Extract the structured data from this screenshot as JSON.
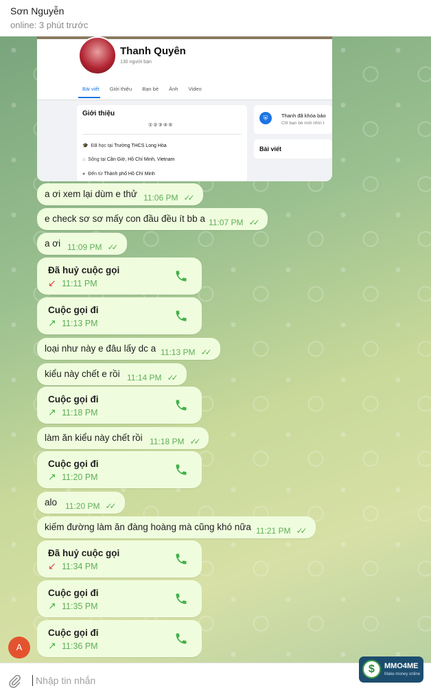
{
  "header": {
    "name": "Sơn Nguyễn",
    "status": "online: 3 phút trước"
  },
  "shared_screenshot": {
    "profile_name": "Thanh Quyên",
    "friends": "130 người bạn",
    "tabs": [
      "Bài viết",
      "Giới thiệu",
      "Bạn bè",
      "Ảnh",
      "Video"
    ],
    "intro_title": "Giới thiệu",
    "intro_dots": "①②③④⑤",
    "intro_rows": [
      {
        "prefix": "Đã học tại",
        "value": "Trường THCS Long Hòa"
      },
      {
        "prefix": "Sống tại",
        "value": "Cần Giờ, Hồ Chí Minh, Vietnam"
      },
      {
        "prefix": "Đến từ",
        "value": "Thành phố Hồ Chí Minh"
      }
    ],
    "lock_title": "Thanh đã khóa bảo",
    "lock_sub": "Chỉ bạn bè mới nhìn t",
    "posts_title": "Bài viết"
  },
  "messages": [
    {
      "type": "text",
      "text": "a ơi xem lại dùm e thử",
      "time": "11:06 PM"
    },
    {
      "type": "text",
      "text": "e check sơ sơ mấy con đầu đều  ít bb a",
      "time": "11:07 PM"
    },
    {
      "type": "text",
      "text": "a ơi",
      "time": "11:09 PM"
    },
    {
      "type": "call",
      "title": "Đã huỷ cuộc gọi",
      "time": "11:11 PM",
      "direction": "missed"
    },
    {
      "type": "call",
      "title": "Cuộc gọi đi",
      "time": "11:13 PM",
      "direction": "outgoing"
    },
    {
      "type": "text",
      "text": "loại như này e đâu lấy dc a",
      "time": "11:13 PM"
    },
    {
      "type": "text",
      "text": "kiểu này chết e rồi",
      "time": "11:14 PM"
    },
    {
      "type": "call",
      "title": "Cuộc gọi đi",
      "time": "11:18 PM",
      "direction": "outgoing"
    },
    {
      "type": "text",
      "text": "làm ăn kiểu này chết rồi",
      "time": "11:18 PM"
    },
    {
      "type": "call",
      "title": "Cuộc gọi đi",
      "time": "11:20 PM",
      "direction": "outgoing"
    },
    {
      "type": "text",
      "text": "alo",
      "time": "11:20 PM"
    },
    {
      "type": "text",
      "text": "kiếm đường làm ăn đàng hoàng mà cũng khó nữa",
      "time": "11:21 PM"
    },
    {
      "type": "call",
      "title": "Đã huỷ cuộc gọi",
      "time": "11:34 PM",
      "direction": "missed"
    },
    {
      "type": "call",
      "title": "Cuộc gọi đi",
      "time": "11:35 PM",
      "direction": "outgoing"
    },
    {
      "type": "call",
      "title": "Cuộc gọi đi",
      "time": "11:36 PM",
      "direction": "outgoing"
    }
  ],
  "sender_avatar": "A",
  "input": {
    "placeholder": "Nhập tin nhắn"
  },
  "watermark": {
    "name": "MMO4ME",
    "tagline": "Make money online"
  },
  "colors": {
    "bubble": "#effdde",
    "tick": "#5fae57",
    "missed": "#e0453a",
    "outgoing": "#44b04a"
  }
}
